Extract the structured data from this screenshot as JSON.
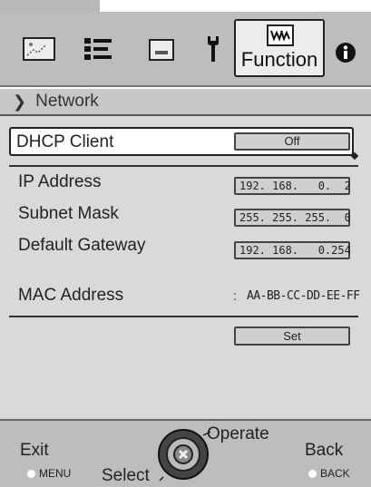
{
  "toolbar": {
    "icons": [
      "picture-adjust-icon",
      "settings-list-icon",
      "display-icon",
      "wrench-icon",
      "function-icon",
      "info-icon"
    ],
    "function_label": "Function"
  },
  "section": {
    "title": "Network"
  },
  "dhcp": {
    "label": "DHCP Client",
    "value": "Off"
  },
  "ip": {
    "label": "IP Address",
    "value": "192. 168.   0.  2"
  },
  "subnet": {
    "label": "Subnet Mask",
    "value": "255. 255. 255.  0"
  },
  "gateway": {
    "label": "Default Gateway",
    "value": "192. 168.   0.254"
  },
  "mac": {
    "label": "MAC Address",
    "separator": ":",
    "value": "AA-BB-CC-DD-EE-FF"
  },
  "set_label": "Set",
  "footer": {
    "exit_label": "Exit",
    "menu_label": "MENU",
    "select_label": "Select",
    "operate_label": "Operate",
    "back_label": "Back",
    "back_key_label": "BACK"
  }
}
